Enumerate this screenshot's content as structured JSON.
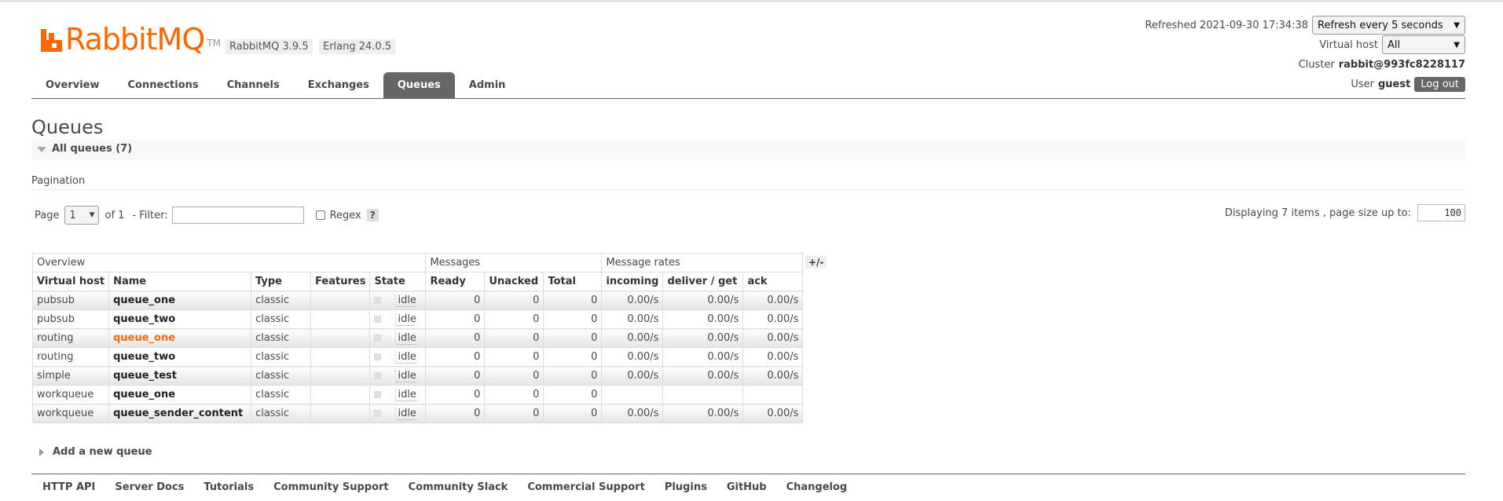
{
  "header": {
    "logo_text": "RabbitMQ",
    "logo_tm": "TM",
    "version_badge": "RabbitMQ 3.9.5",
    "erlang_badge": "Erlang 24.0.5",
    "refreshed_label": "Refreshed 2021-09-30 17:34:38",
    "refresh_option": "Refresh every 5 seconds",
    "vhost_label": "Virtual host",
    "vhost_value": "All",
    "cluster_label": "Cluster",
    "cluster_name": "rabbit@993fc8228117",
    "user_label": "User",
    "user_name": "guest",
    "logout_label": "Log out"
  },
  "tabs": [
    {
      "label": "Overview",
      "active": false
    },
    {
      "label": "Connections",
      "active": false
    },
    {
      "label": "Channels",
      "active": false
    },
    {
      "label": "Exchanges",
      "active": false
    },
    {
      "label": "Queues",
      "active": true
    },
    {
      "label": "Admin",
      "active": false
    }
  ],
  "page": {
    "title": "Queues",
    "section_title": "All queues (7)",
    "pagination_label": "Pagination",
    "page_label": "Page",
    "page_value": "1",
    "of_label": "of 1",
    "filter_label": "- Filter:",
    "filter_value": "",
    "regex_label": "Regex",
    "help_label": "?",
    "display_info": "Displaying 7 items , page size up to:",
    "page_size": "100",
    "columns_toggle": "+/-",
    "add_queue_label": "Add a new queue"
  },
  "table": {
    "groups": [
      "Overview",
      "Messages",
      "Message rates"
    ],
    "columns": [
      "Virtual host",
      "Name",
      "Type",
      "Features",
      "State",
      "Ready",
      "Unacked",
      "Total",
      "incoming",
      "deliver / get",
      "ack"
    ],
    "rows": [
      {
        "vhost": "pubsub",
        "name": "queue_one",
        "type": "classic",
        "features": "",
        "state": "idle",
        "ready": "0",
        "unacked": "0",
        "total": "0",
        "incoming": "0.00/s",
        "deliver": "0.00/s",
        "ack": "0.00/s",
        "highlight": false
      },
      {
        "vhost": "pubsub",
        "name": "queue_two",
        "type": "classic",
        "features": "",
        "state": "idle",
        "ready": "0",
        "unacked": "0",
        "total": "0",
        "incoming": "0.00/s",
        "deliver": "0.00/s",
        "ack": "0.00/s",
        "highlight": false
      },
      {
        "vhost": "routing",
        "name": "queue_one",
        "type": "classic",
        "features": "",
        "state": "idle",
        "ready": "0",
        "unacked": "0",
        "total": "0",
        "incoming": "0.00/s",
        "deliver": "0.00/s",
        "ack": "0.00/s",
        "highlight": true
      },
      {
        "vhost": "routing",
        "name": "queue_two",
        "type": "classic",
        "features": "",
        "state": "idle",
        "ready": "0",
        "unacked": "0",
        "total": "0",
        "incoming": "0.00/s",
        "deliver": "0.00/s",
        "ack": "0.00/s",
        "highlight": false
      },
      {
        "vhost": "simple",
        "name": "queue_test",
        "type": "classic",
        "features": "",
        "state": "idle",
        "ready": "0",
        "unacked": "0",
        "total": "0",
        "incoming": "0.00/s",
        "deliver": "0.00/s",
        "ack": "0.00/s",
        "highlight": false
      },
      {
        "vhost": "workqueue",
        "name": "queue_one",
        "type": "classic",
        "features": "",
        "state": "idle",
        "ready": "0",
        "unacked": "0",
        "total": "0",
        "incoming": "",
        "deliver": "",
        "ack": "",
        "highlight": false
      },
      {
        "vhost": "workqueue",
        "name": "queue_sender_content",
        "type": "classic",
        "features": "",
        "state": "idle",
        "ready": "0",
        "unacked": "0",
        "total": "0",
        "incoming": "0.00/s",
        "deliver": "0.00/s",
        "ack": "0.00/s",
        "highlight": false
      }
    ]
  },
  "footer": {
    "links": [
      "HTTP API",
      "Server Docs",
      "Tutorials",
      "Community Support",
      "Community Slack",
      "Commercial Support",
      "Plugins",
      "GitHub",
      "Changelog"
    ]
  },
  "colors": {
    "brand": "#ff6600",
    "active_tab": "#666666",
    "text": "#484848"
  }
}
